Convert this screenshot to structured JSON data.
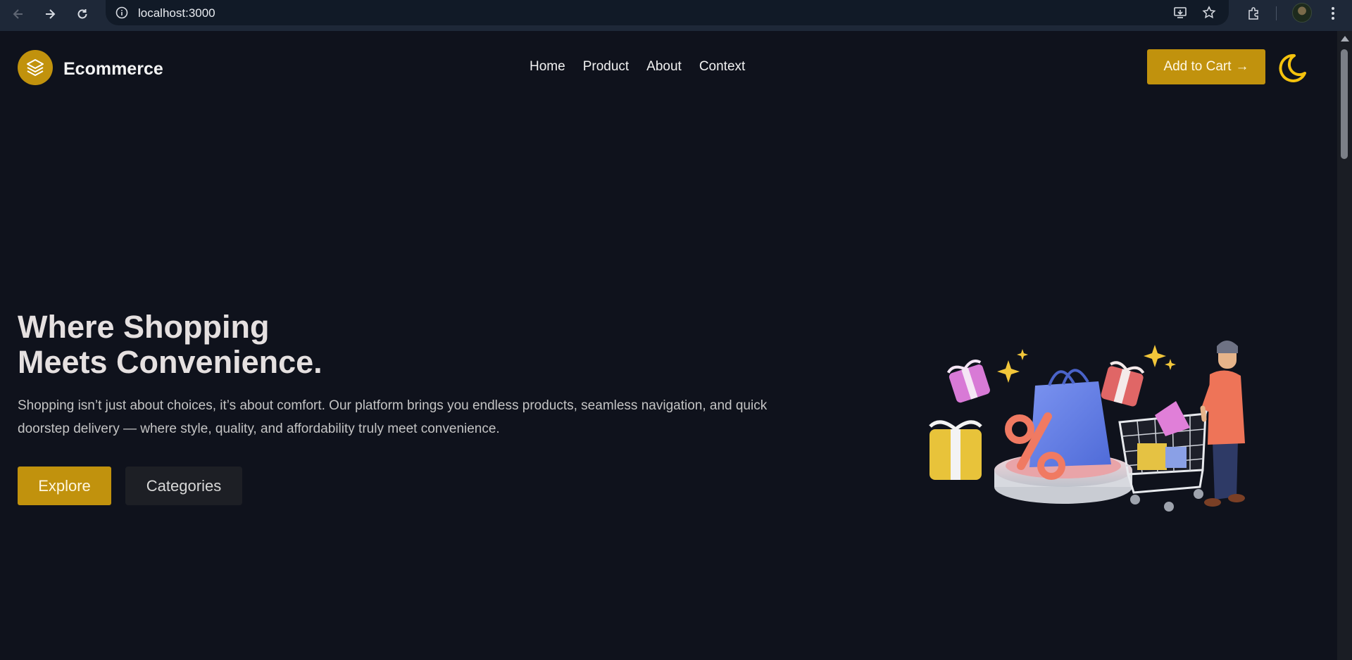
{
  "browser": {
    "url": "localhost:3000"
  },
  "header": {
    "brand": "Ecommerce",
    "nav": [
      "Home",
      "Product",
      "About",
      "Context"
    ],
    "cart_button": "Add to Cart",
    "cart_arrow": "→"
  },
  "hero": {
    "title_line1": "Where Shopping",
    "title_line2": "Meets Convenience.",
    "description": "Shopping isn’t just about choices, it’s about comfort. Our platform brings you endless products, seamless navigation, and quick doorstep delivery — where style, quality, and affordability truly meet convenience.",
    "explore_label": "Explore",
    "categories_label": "Categories"
  },
  "colors": {
    "accent": "#c1920d",
    "background": "#0f121c",
    "chrome": "#1e2838",
    "moon": "#f4c20d"
  },
  "icons": {
    "logo": "layers-icon",
    "theme": "moon-icon"
  }
}
